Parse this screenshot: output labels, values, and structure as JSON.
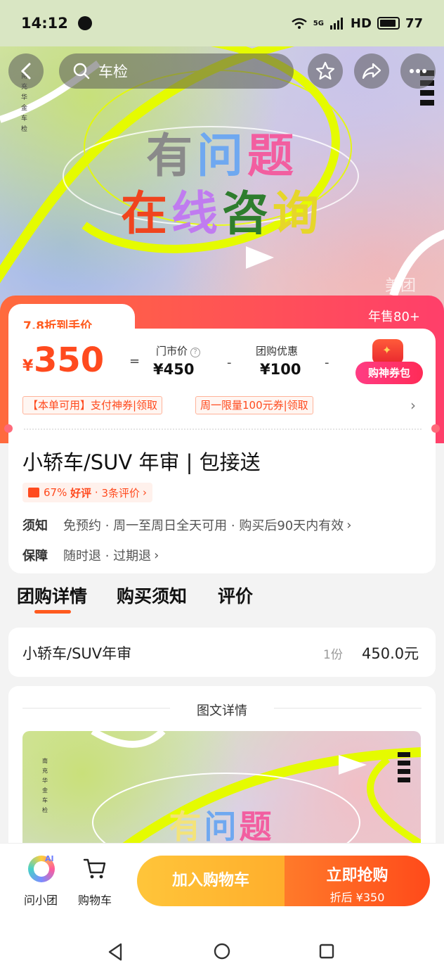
{
  "status_bar": {
    "time": "14:12",
    "network": "5G",
    "hd": "HD",
    "battery": "77"
  },
  "top_nav": {
    "search_text": "车检"
  },
  "hero": {
    "line1_chars": [
      "有",
      "问",
      "题"
    ],
    "line2_chars": [
      "在",
      "线",
      "咨",
      "询"
    ],
    "vertical_text": "南充华金车检",
    "watermark": "美团"
  },
  "price_card": {
    "discount_label": "7.8折到手价",
    "annual_sales": "年售80+",
    "currency": "¥",
    "final_price": "350",
    "equals": "=",
    "store_price_label": "门市价",
    "store_price": "¥450",
    "minus": "-",
    "group_discount_label": "团购优惠",
    "group_discount": "¥100",
    "coupon_pack_label": "购神券包",
    "coupon_tags": [
      "【本单可用】支付神券|领取",
      "周一限量100元券|领取"
    ],
    "accent_color": "#ff4a1e"
  },
  "product": {
    "title": "小轿车/SUV 年审 | 包接送",
    "rating_percent": "67%",
    "rating_label": "好评",
    "review_count": "3条评价",
    "notice_key": "须知",
    "notice_val": "免预约 · 周一至周日全天可用 · 购买后90天内有效",
    "guarantee_key": "保障",
    "guarantee_val": "随时退 · 过期退"
  },
  "tabs": [
    "团购详情",
    "购买须知",
    "评价"
  ],
  "item": {
    "name": "小轿车/SUV年审",
    "qty": "1份",
    "price": "450.0元"
  },
  "detail": {
    "heading": "图文详情",
    "image_text_chars": [
      "有",
      "问",
      "题"
    ],
    "vertical_text": "南充华金车检"
  },
  "bottom_bar": {
    "assistant_label": "问小团",
    "assistant_badge": "AI",
    "cart_label": "购物车",
    "add_to_cart": "加入购物车",
    "buy_now": "立即抢购",
    "buy_now_sub": "折后 ¥350"
  }
}
